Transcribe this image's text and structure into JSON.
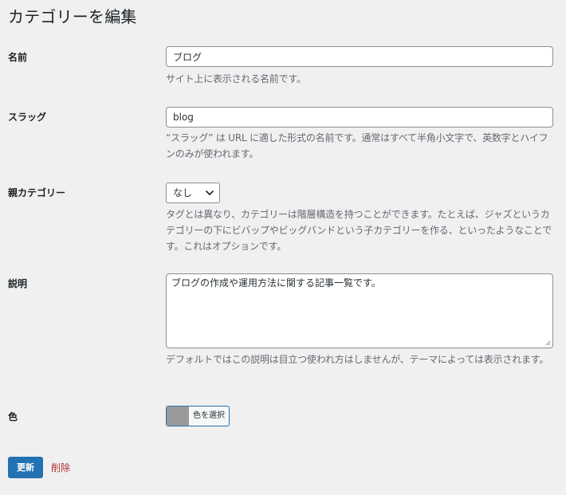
{
  "page": {
    "title": "カテゴリーを編集"
  },
  "fields": {
    "name": {
      "label": "名前",
      "value": "ブログ",
      "description": "サイト上に表示される名前です。"
    },
    "slug": {
      "label": "スラッグ",
      "value": "blog",
      "description": "“スラッグ” は URL に適した形式の名前です。通常はすべて半角小文字で、英数字とハイフンのみが使われます。"
    },
    "parent": {
      "label": "親カテゴリー",
      "selected": "なし",
      "description": "タグとは異なり、カテゴリーは階層構造を持つことができます。たとえば、ジャズというカテゴリーの下にビバップやビッグバンドという子カテゴリーを作る、といったようなことです。これはオプションです。"
    },
    "description": {
      "label": "説明",
      "value": "ブログの作成や運用方法に関する記事一覧です。",
      "description": "デフォルトではこの説明は目立つ使われ方はしませんが、テーマによっては表示されます。"
    },
    "color": {
      "label": "色",
      "button_label": "色を選択",
      "swatch_color": "#9a9a9a"
    }
  },
  "actions": {
    "update_label": "更新",
    "delete_label": "削除"
  },
  "colors": {
    "background": "#f0f0f1",
    "primary": "#2271b1",
    "delete": "#b32d2e",
    "description_text": "#646970"
  }
}
